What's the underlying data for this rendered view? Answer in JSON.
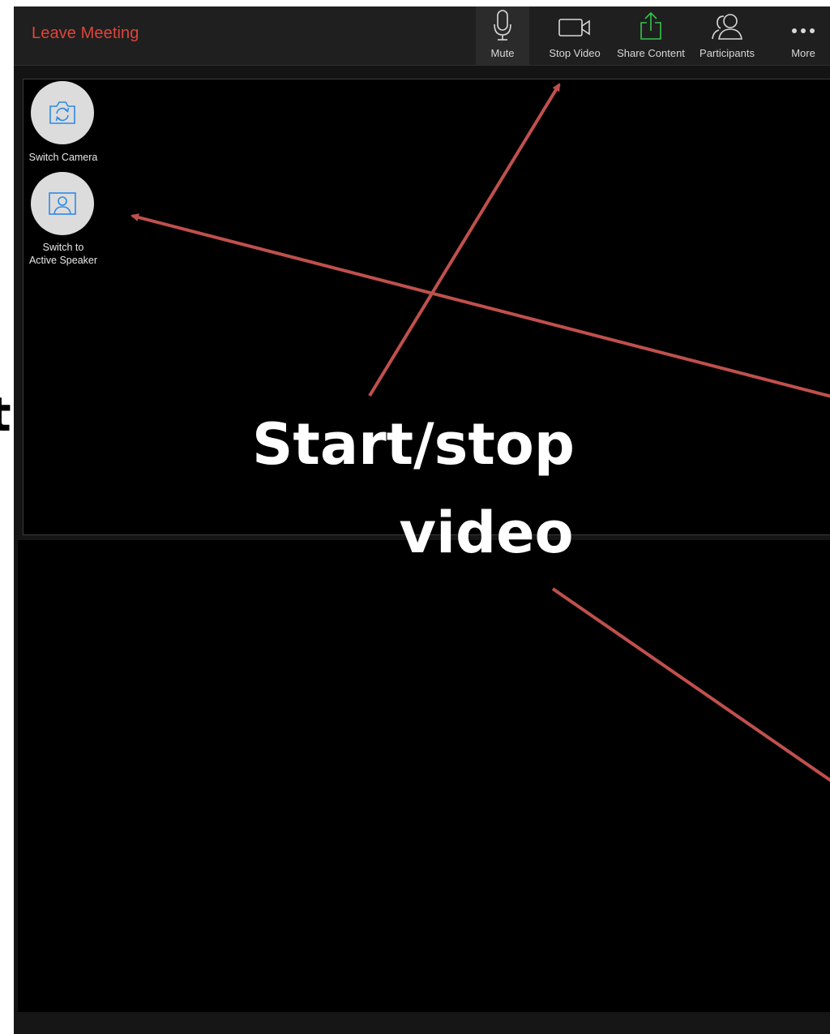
{
  "left_annotation_glyph": "t",
  "toolbar": {
    "leave_label": "Leave Meeting",
    "mute_label": "Mute",
    "stop_video_label": "Stop Video",
    "share_label": "Share Content",
    "participants_label": "Participants",
    "more_label": "More"
  },
  "controls": {
    "switch_camera_label": "Switch Camera",
    "switch_speaker_label_line1": "Switch to",
    "switch_speaker_label_line2": "Active Speaker"
  },
  "annotation": {
    "caption_line1": "Start/stop",
    "caption_line2": "video",
    "arrow_color": "#c0504d"
  },
  "colors": {
    "leave": "#e0443a",
    "share_icon": "#35c44b",
    "accent_icon": "#2e8ae6"
  },
  "icons": [
    "microphone-icon",
    "video-camera-icon",
    "share-upload-icon",
    "participants-icon",
    "more-dots-icon",
    "switch-camera-icon",
    "active-speaker-icon"
  ]
}
